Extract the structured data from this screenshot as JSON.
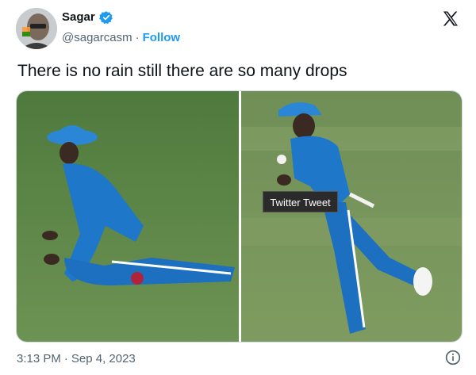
{
  "author": {
    "name": "Sagar",
    "handle": "@sagarcasm",
    "separator": "·",
    "follow_label": "Follow"
  },
  "tweet": {
    "text": "There is no rain still there are so many drops"
  },
  "tooltip": {
    "text": "Twitter Tweet"
  },
  "footer": {
    "time": "3:13 PM",
    "separator": "·",
    "date": "Sep 4, 2023"
  },
  "icons": {
    "verified": "verified-badge-icon",
    "platform": "x-logo-icon",
    "info": "info-icon"
  },
  "colors": {
    "accent": "#1d9bf0",
    "secondary_text": "#536471",
    "pitch_green": "#5f8a4a",
    "jersey_blue": "#1f77c9"
  }
}
